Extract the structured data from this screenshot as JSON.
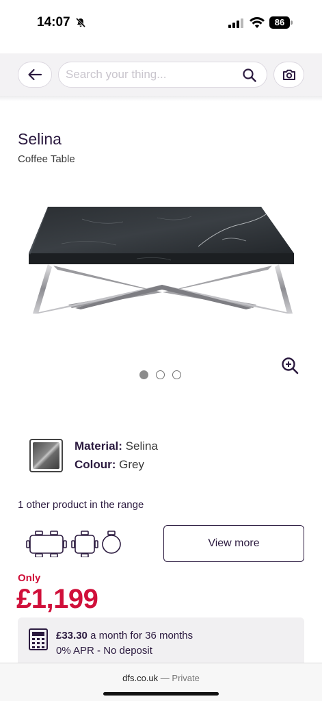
{
  "status_bar": {
    "time": "14:07",
    "battery": "86",
    "icons": [
      "bell-slash-icon",
      "cellular-signal-icon",
      "wifi-icon",
      "battery-icon"
    ]
  },
  "search_header": {
    "placeholder": "Search your thing...",
    "value": "",
    "icons": [
      "back-arrow-icon",
      "search-icon",
      "camera-icon"
    ]
  },
  "product": {
    "title": "Selina",
    "subtitle": "Coffee Table",
    "image_description_icon": "coffee-table-image",
    "zoom_icon": "zoom-in-icon",
    "carousel": {
      "count": 3,
      "active_index": 0
    }
  },
  "specs": {
    "material_label": "Material:",
    "material_value": "Selina",
    "colour_label": "Colour:",
    "colour_value": "Grey"
  },
  "range": {
    "text": "1 other product in the range",
    "icons": [
      "rectangular-table-icon",
      "square-table-icon",
      "round-table-icon"
    ],
    "view_more_label": "View more"
  },
  "pricing": {
    "only_label": "Only",
    "price": "£1,199",
    "finance_amount": "£33.30",
    "finance_term": "a month for 36 months",
    "finance_detail": "0% APR - No deposit",
    "accent_color": "#d0103a"
  },
  "browser": {
    "domain": "dfs.co.uk",
    "separator": "—",
    "mode": "Private"
  },
  "colors": {
    "brand_text": "#2b1a3f",
    "price_red": "#d0103a",
    "header_bg": "#f3f2f4"
  }
}
